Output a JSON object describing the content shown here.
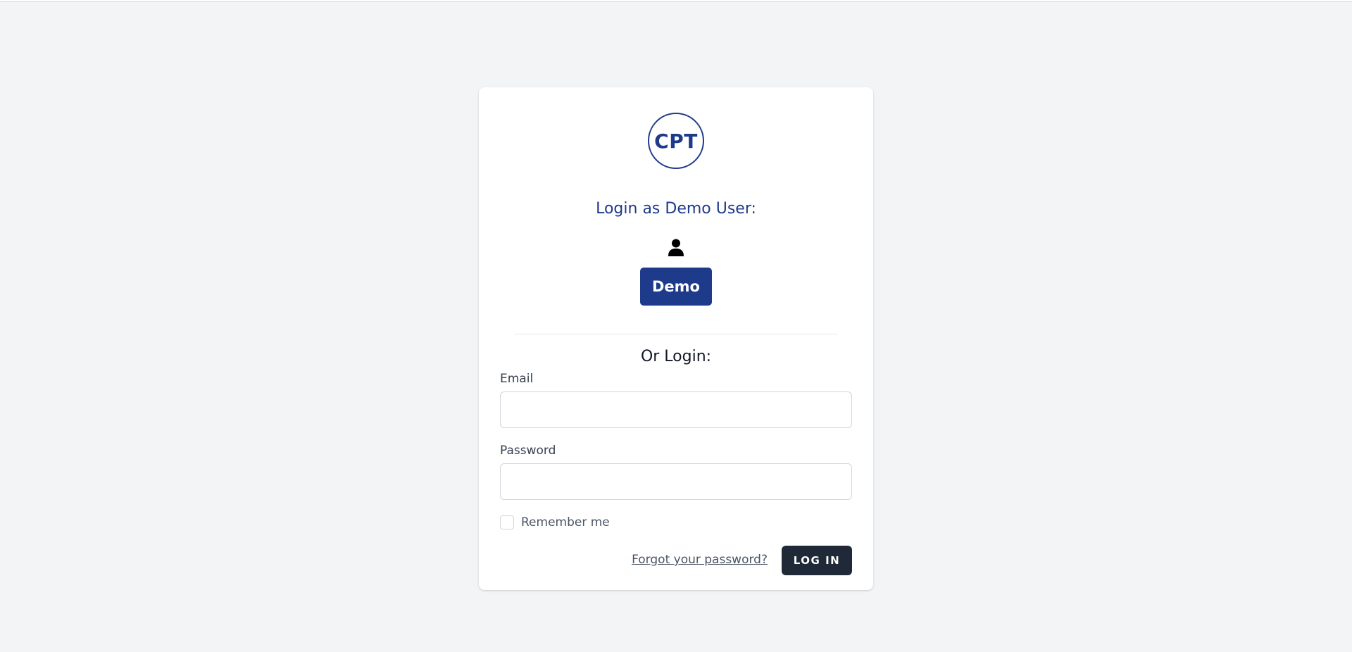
{
  "logo": {
    "text": "CPT"
  },
  "demo": {
    "heading": "Login as Demo User:",
    "user_icon": "user-icon",
    "button_label": "Demo"
  },
  "login": {
    "heading": "Or Login:",
    "email_label": "Email",
    "email_value": "",
    "password_label": "Password",
    "password_value": "",
    "remember_label": "Remember me",
    "remember_checked": false,
    "forgot_label": "Forgot your password?",
    "submit_label": "LOG IN"
  },
  "colors": {
    "brand": "#1e3a8a",
    "dark_button": "#1f2937",
    "background": "#f3f4f6"
  }
}
